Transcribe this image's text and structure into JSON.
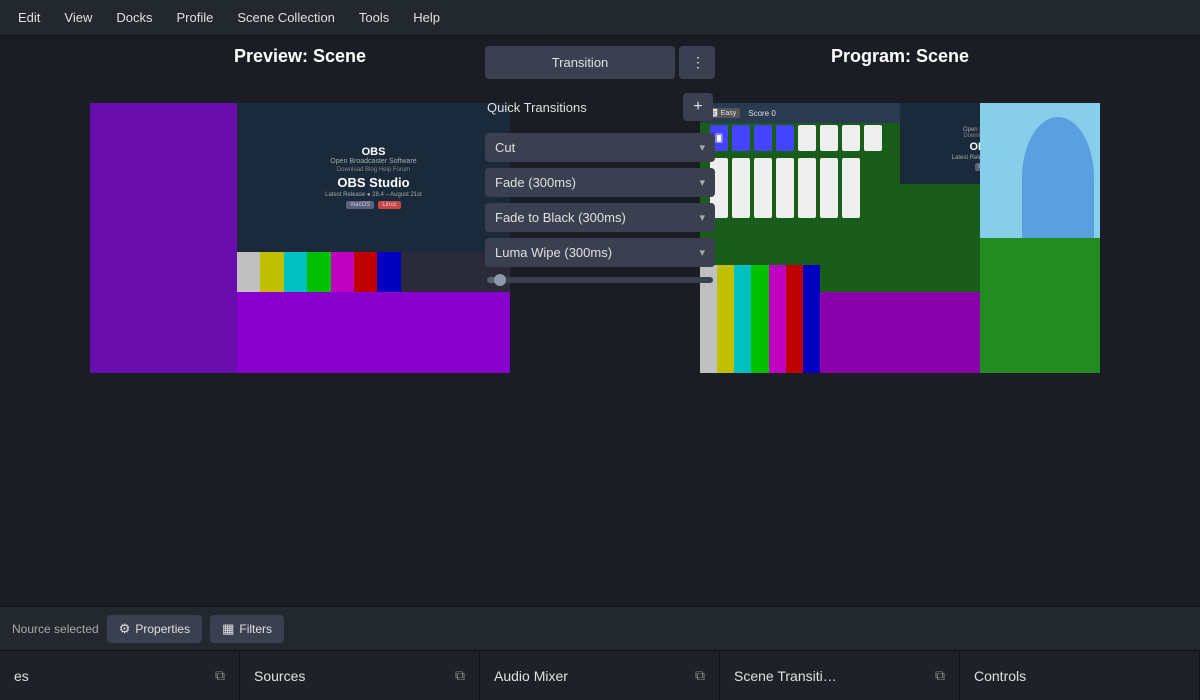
{
  "menubar": {
    "items": [
      "Edit",
      "View",
      "Docks",
      "Profile",
      "Scene Collection",
      "Tools",
      "Help"
    ]
  },
  "preview": {
    "title": "Preview: Scene"
  },
  "program": {
    "title": "Program: Scene"
  },
  "transition": {
    "button_label": "Transition",
    "menu_icon": "⋮",
    "quick_transitions_label": "Quick Transitions",
    "add_icon": "+",
    "selects": [
      {
        "label": "Cut",
        "arrow": "▾"
      },
      {
        "label": "Fade (300ms)",
        "arrow": "▾"
      },
      {
        "label": "Fade to Black (300ms)",
        "arrow": "▾"
      },
      {
        "label": "Luma Wipe (300ms)",
        "arrow": "▾"
      }
    ]
  },
  "bottom_toolbar": {
    "source_text": "ource selected",
    "properties_label": "Properties",
    "properties_icon": "⚙",
    "filters_label": "Filters",
    "filters_icon": "▦"
  },
  "panels": [
    {
      "label": "es",
      "icon": "⧉"
    },
    {
      "label": "Sources",
      "icon": "⧉"
    },
    {
      "label": "Audio Mixer",
      "icon": "⧉"
    },
    {
      "label": "Scene Transiti…",
      "icon": "⧉"
    },
    {
      "label": "Controls",
      "icon": ""
    }
  ]
}
